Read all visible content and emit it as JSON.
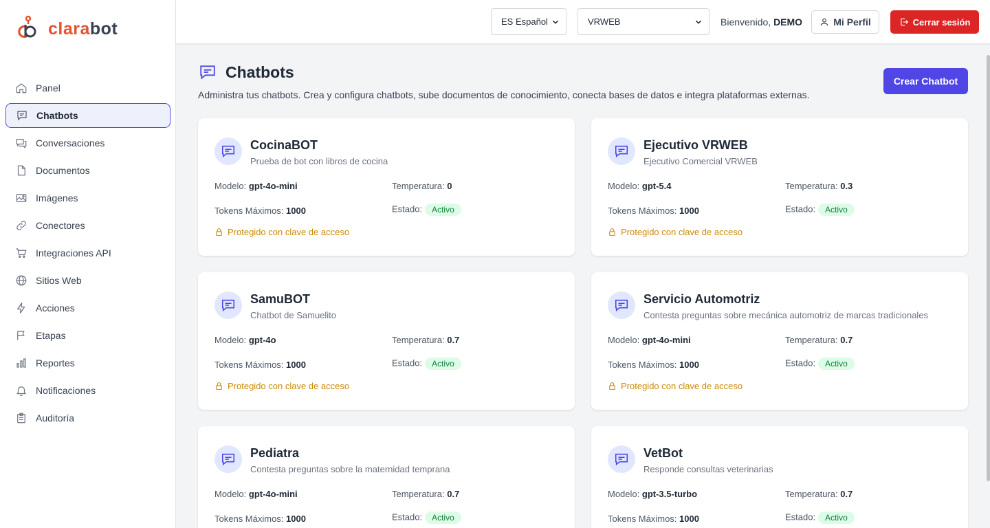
{
  "app": {
    "logo_part1": "clara",
    "logo_part2": "bot"
  },
  "sidebar": {
    "items": [
      {
        "label": "Panel",
        "icon": "home-icon"
      },
      {
        "label": "Chatbots",
        "icon": "chat-icon",
        "active": true
      },
      {
        "label": "Conversaciones",
        "icon": "conversations-icon"
      },
      {
        "label": "Documentos",
        "icon": "document-icon"
      },
      {
        "label": "Imágenes",
        "icon": "image-icon"
      },
      {
        "label": "Conectores",
        "icon": "link-icon"
      },
      {
        "label": "Integraciones API",
        "icon": "cart-icon"
      },
      {
        "label": "Sitios Web",
        "icon": "globe-icon"
      },
      {
        "label": "Acciones",
        "icon": "bolt-icon"
      },
      {
        "label": "Etapas",
        "icon": "flag-icon"
      },
      {
        "label": "Reportes",
        "icon": "bar-chart-icon"
      },
      {
        "label": "Notificaciones",
        "icon": "bell-icon"
      },
      {
        "label": "Auditoría",
        "icon": "clipboard-icon"
      }
    ]
  },
  "header": {
    "language": "ES Español",
    "workspace": "VRWEB",
    "welcome_text": "Bienvenido,",
    "username": "DEMO",
    "profile_label": "Mi Perfil",
    "logout_label": "Cerrar sesión"
  },
  "page": {
    "title": "Chatbots",
    "description": "Administra tus chatbots. Crea y configura chatbots, sube documentos de conocimiento, conecta bases de datos e integra plataformas externas.",
    "create_label": "Crear Chatbot"
  },
  "labels": {
    "model": "Modelo:",
    "temperature": "Temperatura:",
    "max_tokens": "Tokens Máximos:",
    "status": "Estado:",
    "protected": "Protegido con clave de acceso"
  },
  "chatbots": [
    {
      "name": "CocinaBOT",
      "description": "Prueba de bot con libros de cocina",
      "model": "gpt-4o-mini",
      "temperature": "0",
      "max_tokens": "1000",
      "status": "Activo"
    },
    {
      "name": "Ejecutivo VRWEB",
      "description": "Ejecutivo Comercial VRWEB",
      "model": "gpt-5.4",
      "temperature": "0.3",
      "max_tokens": "1000",
      "status": "Activo"
    },
    {
      "name": "SamuBOT",
      "description": "Chatbot de Samuelito",
      "model": "gpt-4o",
      "temperature": "0.7",
      "max_tokens": "1000",
      "status": "Activo"
    },
    {
      "name": "Servicio Automotriz",
      "description": "Contesta preguntas sobre mecánica automotriz de marcas tradicionales",
      "model": "gpt-4o-mini",
      "temperature": "0.7",
      "max_tokens": "1000",
      "status": "Activo"
    },
    {
      "name": "Pediatra",
      "description": "Contesta preguntas sobre la maternidad temprana",
      "model": "gpt-4o-mini",
      "temperature": "0.7",
      "max_tokens": "1000",
      "status": "Activo"
    },
    {
      "name": "VetBot",
      "description": "Responde consultas veterinarias",
      "model": "gpt-3.5-turbo",
      "temperature": "0.7",
      "max_tokens": "1000",
      "status": "Activo"
    }
  ],
  "colors": {
    "accent": "#4f46e5",
    "danger": "#dc2626",
    "warning": "#ca8a04",
    "success": "#15803d"
  }
}
